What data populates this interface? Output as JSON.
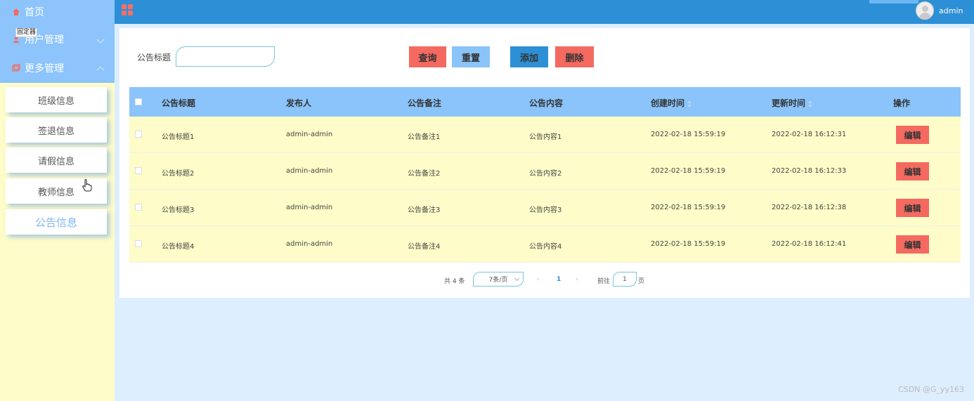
{
  "sidebar": {
    "home": "首页",
    "user_mgmt": "用户管理",
    "more_mgmt": "更多管理",
    "tooltip": "固定器",
    "items": [
      "班级信息",
      "签退信息",
      "请假信息",
      "教师信息",
      "公告信息"
    ],
    "active_item": "公告信息"
  },
  "header": {
    "username": "admin"
  },
  "search": {
    "label": "公告标题",
    "value": ""
  },
  "buttons": {
    "query": "查询",
    "reset": "重置",
    "add": "添加",
    "delete": "删除"
  },
  "table": {
    "columns": [
      "公告标题",
      "发布人",
      "公告备注",
      "公告内容",
      "创建时间",
      "更新时间",
      "操作"
    ],
    "rows": [
      {
        "title": "公告标题1",
        "publisher": "admin-admin",
        "remark": "公告备注1",
        "content": "公告内容1",
        "created": "2022-02-18 15:59:19",
        "updated": "2022-02-18 16:12:31",
        "action": "编辑"
      },
      {
        "title": "公告标题2",
        "publisher": "admin-admin",
        "remark": "公告备注2",
        "content": "公告内容2",
        "created": "2022-02-18 15:59:19",
        "updated": "2022-02-18 16:12:33",
        "action": "编辑"
      },
      {
        "title": "公告标题3",
        "publisher": "admin-admin",
        "remark": "公告备注3",
        "content": "公告内容3",
        "created": "2022-02-18 15:59:19",
        "updated": "2022-02-18 16:12:38",
        "action": "编辑"
      },
      {
        "title": "公告标题4",
        "publisher": "admin-admin",
        "remark": "公告备注4",
        "content": "公告内容4",
        "created": "2022-02-18 15:59:19",
        "updated": "2022-02-18 16:12:41",
        "action": "编辑"
      }
    ]
  },
  "pagination": {
    "total": "共 4 条",
    "page_size": "7条/页",
    "current_page": "1",
    "goto_prefix": "前往",
    "goto_value": "1",
    "goto_suffix": "页"
  },
  "watermark": "CSDN @G_yy163",
  "colors": {
    "topbar": "#2d8fd5",
    "sidebar_top": "#8cc4fb",
    "sidebar_bg": "#fefcc8",
    "danger": "#f46a61",
    "table_header": "#8ac4fb"
  }
}
